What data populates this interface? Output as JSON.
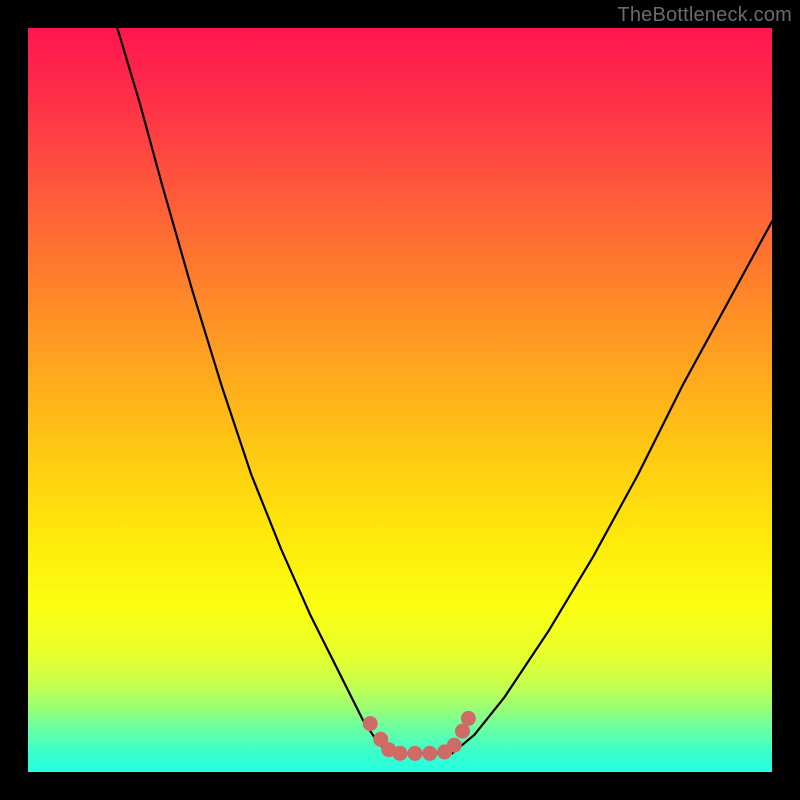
{
  "watermark": "TheBottleneck.com",
  "chart_data": {
    "type": "line",
    "title": "",
    "xlabel": "",
    "ylabel": "",
    "xlim": [
      0,
      100
    ],
    "ylim": [
      0,
      100
    ],
    "grid": false,
    "legend": false,
    "series": [
      {
        "name": "left-curve",
        "x": [
          12,
          15,
          18,
          22,
          26,
          30,
          34,
          38,
          42,
          45,
          47,
          48.5
        ],
        "y": [
          100,
          90,
          79,
          65,
          52,
          40,
          30,
          21,
          13,
          7,
          4,
          2.5
        ]
      },
      {
        "name": "right-curve",
        "x": [
          57,
          60,
          64,
          70,
          76,
          82,
          88,
          94,
          100
        ],
        "y": [
          2.5,
          5,
          10,
          19,
          29,
          40,
          52,
          63,
          74
        ]
      },
      {
        "name": "bottom-flat",
        "x": [
          48.5,
          57
        ],
        "y": [
          2.5,
          2.5
        ]
      }
    ],
    "markers": {
      "name": "highlight-dots",
      "color": "#cf6a66",
      "points": [
        {
          "x": 46.0,
          "y": 6.5
        },
        {
          "x": 47.4,
          "y": 4.4
        },
        {
          "x": 48.5,
          "y": 3.0
        },
        {
          "x": 50.0,
          "y": 2.5
        },
        {
          "x": 52.0,
          "y": 2.5
        },
        {
          "x": 54.0,
          "y": 2.5
        },
        {
          "x": 56.0,
          "y": 2.7
        },
        {
          "x": 57.3,
          "y": 3.6
        },
        {
          "x": 58.4,
          "y": 5.5
        },
        {
          "x": 59.2,
          "y": 7.2
        }
      ]
    },
    "background_gradient": {
      "top": "#ff164f",
      "bottom": "#22ffe1"
    }
  }
}
